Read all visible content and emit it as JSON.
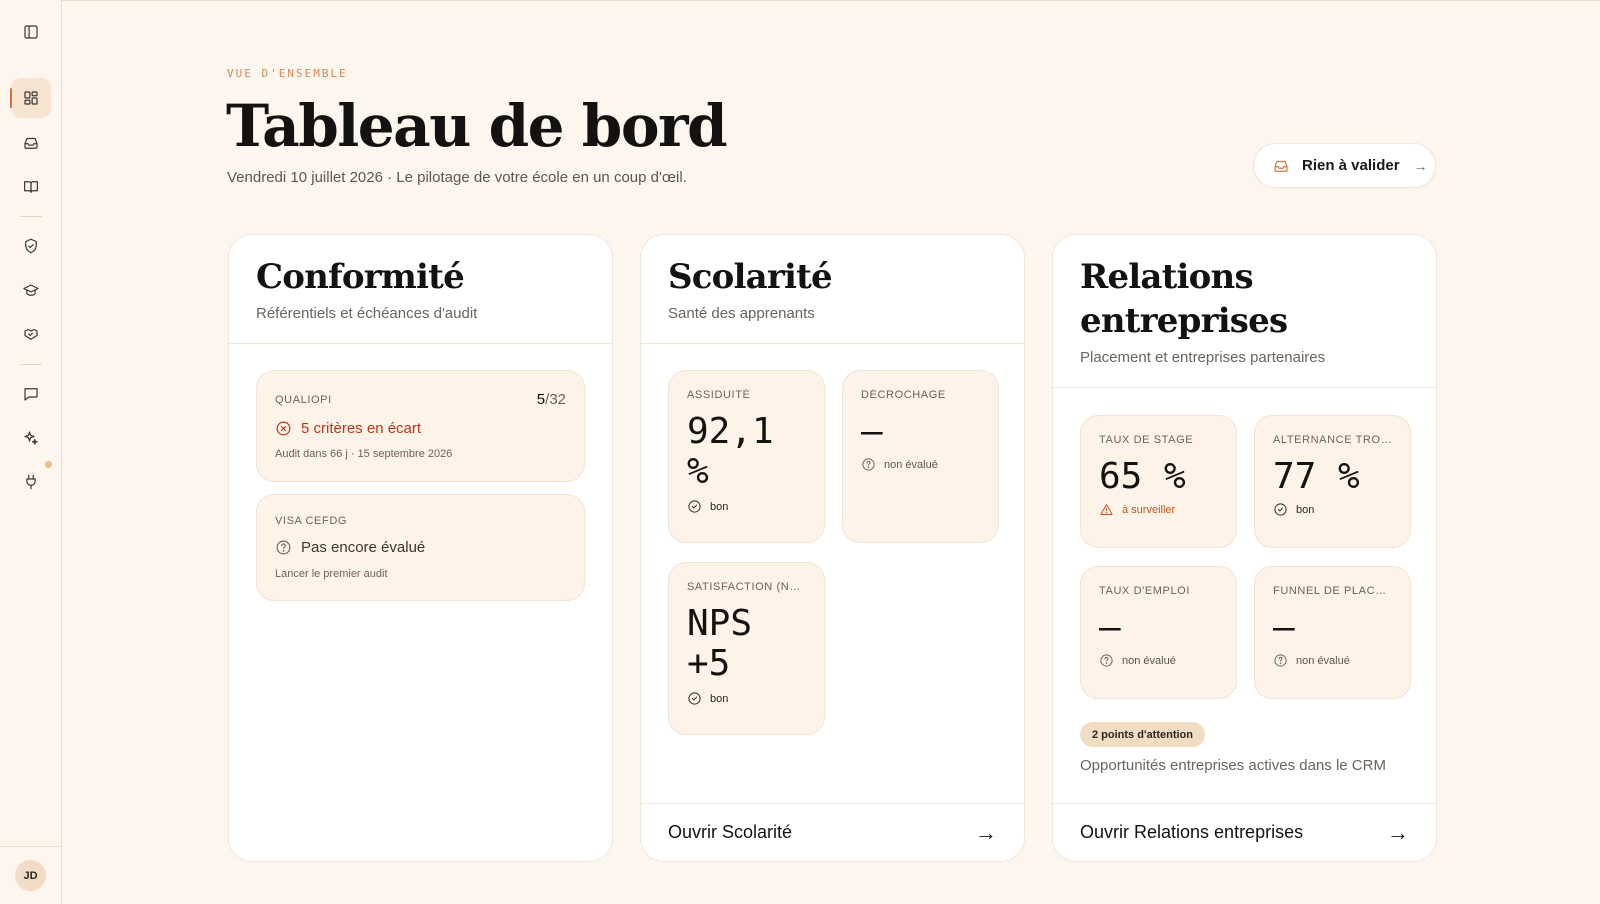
{
  "sidebar": {
    "items": [
      {
        "name": "toggle-sidebar",
        "icon": "sidebar-panel-icon"
      },
      {
        "name": "dashboard",
        "icon": "dashboard-grid-icon",
        "active": true
      },
      {
        "name": "inbox",
        "icon": "inbox-icon"
      },
      {
        "name": "library",
        "icon": "book-icon"
      },
      {
        "name": "compliance",
        "icon": "shield-check-icon"
      },
      {
        "name": "scolarite",
        "icon": "graduation-cap-icon"
      },
      {
        "name": "relations",
        "icon": "handshake-icon"
      },
      {
        "name": "messages",
        "icon": "chat-bubble-icon"
      },
      {
        "name": "assistant",
        "icon": "sparkles-icon"
      },
      {
        "name": "integrations",
        "icon": "plug-icon"
      }
    ],
    "avatar_initials": "JD"
  },
  "header": {
    "eyebrow": "VUE D'ENSEMBLE",
    "title": "Tableau de bord",
    "subtitle": "Vendredi 10 juillet 2026 · Le pilotage de votre école en un coup d'œil.",
    "validate_button": "Rien à valider",
    "validate_icon": "inbox-icon"
  },
  "cards": {
    "conformite": {
      "title": "Conformité",
      "subtitle": "Référentiels et échéances d'audit",
      "qualiopi": {
        "label": "QUALIOPI",
        "score_current": "5",
        "score_sep": "/",
        "score_total": "32",
        "status": "5 critères en écart",
        "status_icon": "x-circle-icon",
        "detail": "Audit dans 66 j · 15 septembre 2026"
      },
      "visa": {
        "label": "VISA CEFDG",
        "status": "Pas encore évalué",
        "status_icon": "question-circle-icon",
        "detail": "Lancer le premier audit"
      }
    },
    "scolarite": {
      "title": "Scolarité",
      "subtitle": "Santé des apprenants",
      "assiduite": {
        "label": "ASSIDUITÉ",
        "value_line1": "92,1",
        "value_line2": "%",
        "status": "bon"
      },
      "decrochage": {
        "label": "DÉCROCHAGE",
        "value": "—",
        "status": "non évalué"
      },
      "satisfaction": {
        "label": "SATISFACTION (NPS)",
        "value_line1": "NPS",
        "value_line2": "+5",
        "status": "bon"
      },
      "footer_link": "Ouvrir Scolarité",
      "footer_arrow": "→"
    },
    "relations": {
      "title_line1": "Relations",
      "title_line2": "entreprises",
      "subtitle": "Placement et entreprises partenaires",
      "taux_stage": {
        "label": "TAUX DE STAGE",
        "value": "65 %",
        "status": "à surveiller"
      },
      "alternance": {
        "label": "ALTERNANCE TROU…",
        "value": "77 %",
        "status": "bon"
      },
      "taux_emploi": {
        "label": "TAUX D'EMPLOI",
        "value": "—",
        "status": "non évalué"
      },
      "funnel": {
        "label": "FUNNEL DE PLACE…",
        "value": "—",
        "status": "non évalué"
      },
      "attention_badge": "2 points d'attention",
      "crm_text": "Opportunités entreprises actives dans le CRM",
      "footer_link": "Ouvrir Relations entreprises",
      "footer_arrow": "→"
    }
  },
  "colors": {
    "background": "#fdf6ee",
    "accent": "#cf8a54",
    "danger": "#b5391c",
    "warning": "#c0541f",
    "card_block": "#fdf3e8",
    "badge": "#f3dcc4"
  }
}
